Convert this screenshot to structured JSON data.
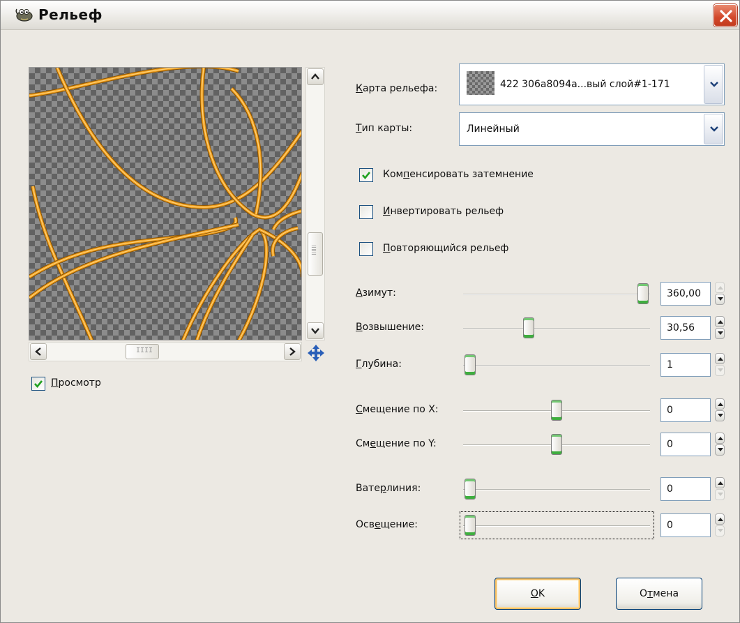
{
  "window": {
    "title": "Рельеф",
    "close_label": "×"
  },
  "preview": {
    "checkbox_label_u": "П",
    "checkbox_label_rest": "росмотр",
    "checked": true,
    "scroll_grip": "IIII"
  },
  "bump_map": {
    "label_u": "К",
    "label_rest": "арта рельефа:",
    "value": "422 306a8094a...вый слой#1-171"
  },
  "map_type": {
    "label_u": "Т",
    "label_rest": "ип карты:",
    "value": "Линейный"
  },
  "options": [
    {
      "pre": "Ком",
      "u": "п",
      "post": "енсировать затемнение",
      "checked": true
    },
    {
      "pre": "",
      "u": "И",
      "post": "нвертировать рельеф",
      "checked": false
    },
    {
      "pre": "",
      "u": "П",
      "post": "овторяющийся рельеф",
      "checked": false
    }
  ],
  "sliders": [
    {
      "pre": "",
      "u": "А",
      "post": "зимут:",
      "value": "360,00",
      "level": 1.0,
      "up_disabled": true,
      "down_disabled": false
    },
    {
      "pre": "",
      "u": "В",
      "post": "озвышение:",
      "value": "30,56",
      "level": 0.34,
      "up_disabled": false,
      "down_disabled": false
    },
    {
      "pre": "",
      "u": "Г",
      "post": "лубина:",
      "value": "1",
      "level": 0.0,
      "up_disabled": false,
      "down_disabled": true
    },
    {
      "pre": "",
      "u": "С",
      "post": "мещение по X:",
      "value": "0",
      "level": 0.5,
      "up_disabled": false,
      "down_disabled": false
    },
    {
      "pre": "См",
      "u": "е",
      "post": "щение по Y:",
      "value": "0",
      "level": 0.5,
      "up_disabled": false,
      "down_disabled": false
    },
    {
      "pre": "Вате",
      "u": "р",
      "post": "линия:",
      "value": "0",
      "level": 0.0,
      "up_disabled": false,
      "down_disabled": true
    },
    {
      "pre": "Осв",
      "u": "е",
      "post": "щение:",
      "value": "0",
      "level": 0.0,
      "up_disabled": false,
      "down_disabled": true
    }
  ],
  "buttons": {
    "ok_u": "O",
    "ok_rest": "K",
    "cancel_pre": "О",
    "cancel_u": "т",
    "cancel_rest": "мена"
  },
  "colors": {
    "ring": "#f0a020",
    "checker_dark": "#626262",
    "checker_light": "#8c8c8c",
    "check_mark": "#21a121",
    "knob_accent": "#3fae3f"
  },
  "icons": [
    "gimp-icon",
    "close-icon",
    "move-icon",
    "checkmark-icon",
    "chevron-down-icon",
    "arrow-up-icon",
    "arrow-down-icon",
    "arrow-left-icon",
    "arrow-right-icon",
    "spin-up-icon",
    "spin-down-icon"
  ]
}
